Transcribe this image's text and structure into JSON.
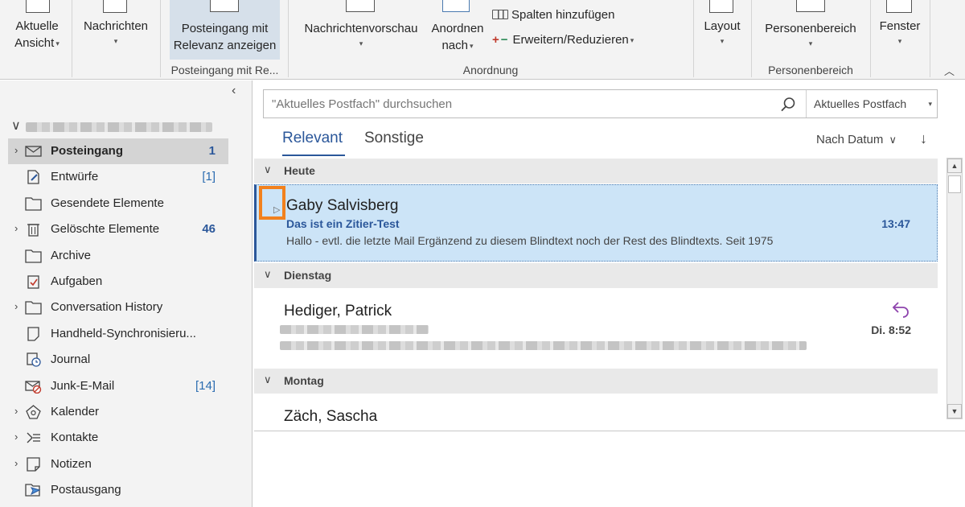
{
  "ribbon": {
    "view": {
      "line1": "Aktuelle",
      "line2": "Ansicht"
    },
    "messages": {
      "label": "Nachrichten"
    },
    "focused": {
      "line1": "Posteingang mit",
      "line2": "Relevanz anzeigen",
      "group": "Posteingang mit Re..."
    },
    "preview": {
      "label": "Nachrichtenvorschau"
    },
    "arrange": {
      "line1": "Anordnen",
      "line2": "nach"
    },
    "add_columns": "Spalten hinzufügen",
    "expand_collapse": "Erweitern/Reduzieren",
    "arrangement_group": "Anordnung",
    "layout": {
      "label": "Layout"
    },
    "people": {
      "label": "Personenbereich",
      "group": "Personenbereich"
    },
    "window": {
      "label": "Fenster"
    }
  },
  "folders": [
    {
      "name": "Posteingang",
      "count": "1",
      "icon": "inbox-icon",
      "expandable": true
    },
    {
      "name": "Entwürfe",
      "count": "[1]",
      "icon": "drafts-icon",
      "expandable": false
    },
    {
      "name": "Gesendete Elemente",
      "count": "",
      "icon": "folder-icon",
      "expandable": false
    },
    {
      "name": "Gelöschte Elemente",
      "count": "46",
      "icon": "trash-icon",
      "expandable": true
    },
    {
      "name": "Archive",
      "count": "",
      "icon": "folder-icon",
      "expandable": false
    },
    {
      "name": "Aufgaben",
      "count": "",
      "icon": "tasks-icon",
      "expandable": false
    },
    {
      "name": "Conversation History",
      "count": "",
      "icon": "folder-icon",
      "expandable": true
    },
    {
      "name": "Handheld-Synchronisieru...",
      "count": "",
      "icon": "note-icon",
      "expandable": false
    },
    {
      "name": "Journal",
      "count": "",
      "icon": "journal-icon",
      "expandable": false
    },
    {
      "name": "Junk-E-Mail",
      "count": "[14]",
      "icon": "junk-icon",
      "expandable": false
    },
    {
      "name": "Kalender",
      "count": "",
      "icon": "calendar-icon",
      "expandable": true
    },
    {
      "name": "Kontakte",
      "count": "",
      "icon": "contacts-icon",
      "expandable": true
    },
    {
      "name": "Notizen",
      "count": "",
      "icon": "notes-icon",
      "expandable": true
    },
    {
      "name": "Postausgang",
      "count": "",
      "icon": "outbox-icon",
      "expandable": false
    }
  ],
  "search": {
    "placeholder": "\"Aktuelles Postfach\" durchsuchen",
    "scope": "Aktuelles Postfach"
  },
  "tabs": {
    "focused": "Relevant",
    "other": "Sonstige"
  },
  "sort": {
    "label": "Nach Datum",
    "direction": "↓"
  },
  "groups": {
    "today": "Heute",
    "tuesday": "Dienstag",
    "monday": "Montag"
  },
  "messages": [
    {
      "sender": "Gaby Salvisberg",
      "subject": "Das ist ein Zitier-Test",
      "preview": "Hallo - evtl. die letzte Mail  Ergänzend zu diesem Blindtext noch der Rest des Blindtexts. Seit 1975",
      "time": "13:47"
    },
    {
      "sender": "Hediger, Patrick",
      "time": "Di. 8:52"
    },
    {
      "sender": "Zäch, Sascha"
    }
  ],
  "colors": {
    "accent": "#2b579a",
    "selection": "#cce4f7",
    "focus_highlight": "#f2811d",
    "reply_icon": "#8e44ad"
  }
}
